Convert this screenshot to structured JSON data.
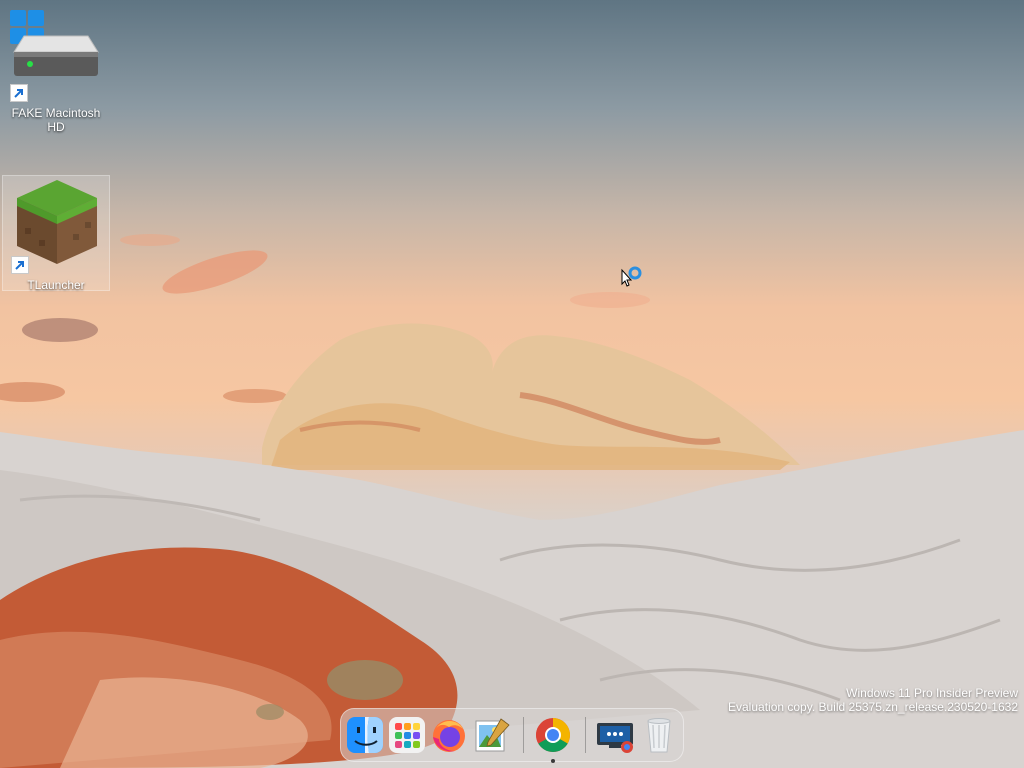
{
  "desktop": {
    "icons": [
      {
        "label": "FAKE Macintosh HD",
        "icon": "hard-drive-icon",
        "shortcut": true
      },
      {
        "label": "TLauncher",
        "icon": "minecraft-grass-block-icon",
        "shortcut": true,
        "selected": true
      }
    ],
    "start_button": {
      "icon": "windows-logo-icon"
    }
  },
  "watermark": {
    "line1": "Windows 11 Pro Insider Preview",
    "line2": "Evaluation copy. Build 25375.zn_release.230520-1632"
  },
  "dock": {
    "apps": [
      {
        "name": "Finder",
        "icon": "finder-icon"
      },
      {
        "name": "Launchpad",
        "icon": "launchpad-icon"
      },
      {
        "name": "Firefox",
        "icon": "firefox-icon"
      },
      {
        "name": "Preview",
        "icon": "preview-icon"
      },
      {
        "name": "Google Chrome",
        "icon": "chrome-icon",
        "running": true
      },
      {
        "name": "Chrome Remote Desktop",
        "icon": "remote-desktop-icon"
      },
      {
        "name": "Trash",
        "icon": "trash-icon"
      }
    ]
  },
  "cursor": {
    "state": "busy"
  }
}
